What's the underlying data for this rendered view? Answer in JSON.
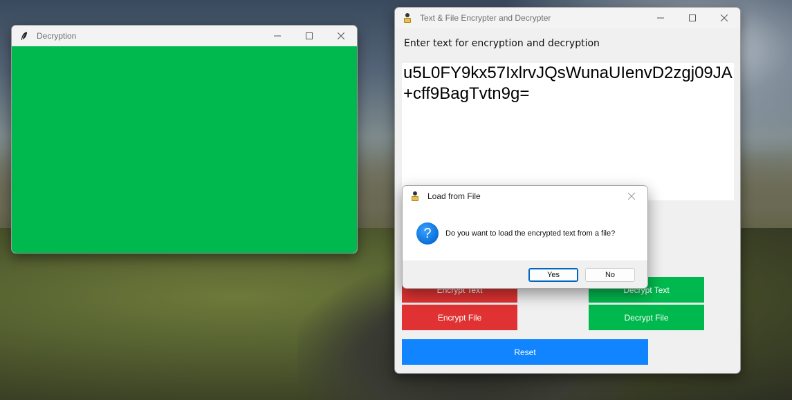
{
  "decryption_window": {
    "title": "Decryption",
    "background_color": "#00b94e",
    "icon": "feather-icon"
  },
  "main_window": {
    "title": "Text & File Encrypter and Decrypter",
    "icon": "lock-person-icon",
    "prompt": "Enter text for encryption and decryption",
    "text_content": "u5L0FY9kx57IxlrvJQsWunaUIenvD2zgj09JA+cff9BagTvtn9g=",
    "buttons": {
      "encrypt_text": "Encrypt Text",
      "decrypt_text": "Decrypt Text",
      "encrypt_file": "Encrypt File",
      "decrypt_file": "Decrypt File",
      "reset": "Reset"
    },
    "colors": {
      "red": "#e03232",
      "green": "#00b94e",
      "blue": "#1185ff"
    }
  },
  "dialog": {
    "title": "Load from File",
    "icon": "question-icon",
    "message": "Do you want to load the encrypted text from a file?",
    "yes_label": "Yes",
    "no_label": "No"
  }
}
